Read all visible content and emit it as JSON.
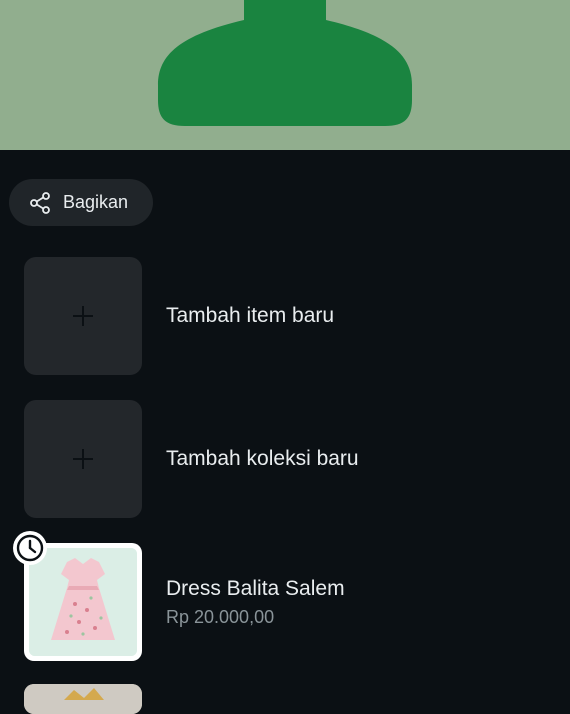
{
  "banner": {
    "colors": {
      "background": "#91ae8e",
      "shape": "#1a8440"
    }
  },
  "share": {
    "label": "Bagikan",
    "icon": "share-icon"
  },
  "actions": [
    {
      "label": "Tambah item baru",
      "icon": "plus-icon"
    },
    {
      "label": "Tambah koleksi baru",
      "icon": "plus-icon"
    }
  ],
  "products": [
    {
      "name": "Dress Balita Salem",
      "price": "Rp 20.000,00",
      "status_icon": "clock-icon"
    }
  ]
}
